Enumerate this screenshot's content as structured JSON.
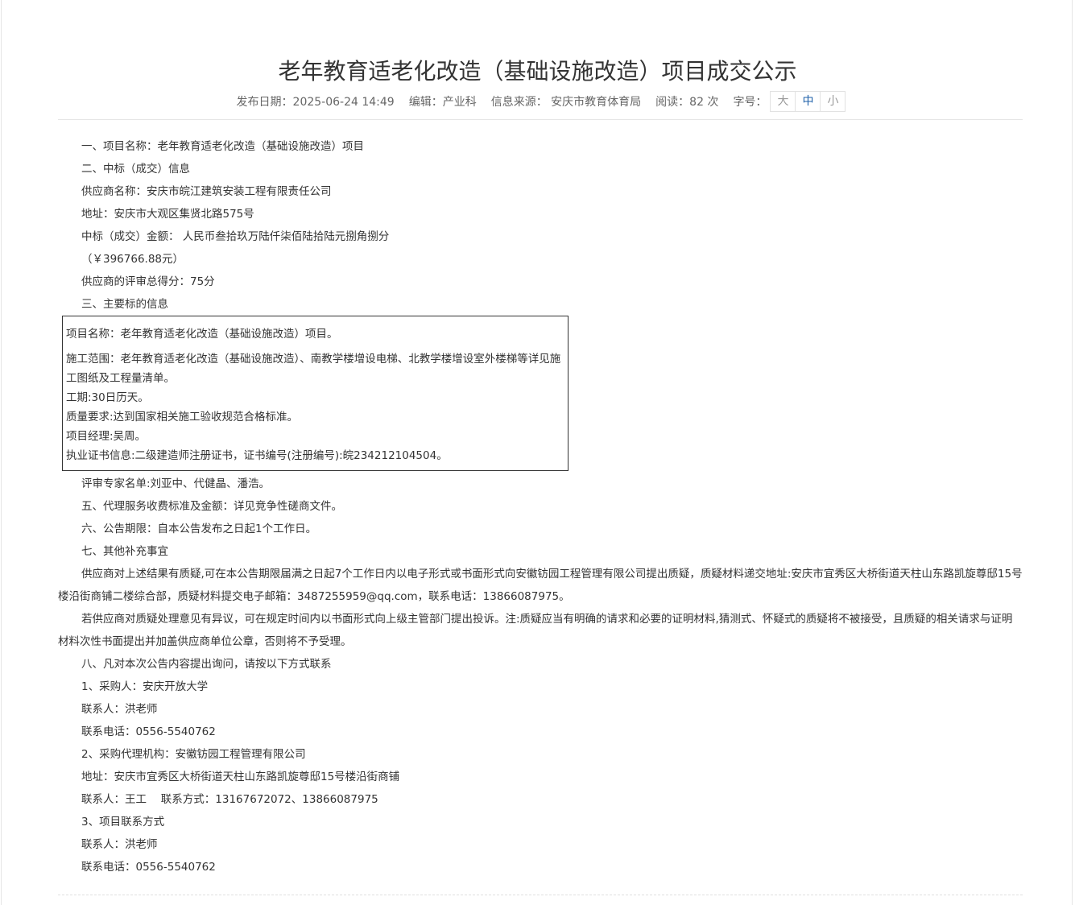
{
  "title": "老年教育适老化改造（基础设施改造）项目成交公示",
  "meta": {
    "publish_date": "发布日期：2025-06-24 14:49",
    "editor": "编辑：产业科",
    "source": "信息来源： 安庆市教育体育局",
    "reads": "阅读：82 次",
    "font_size_label": "字号：",
    "font_sizes": [
      "大",
      "中",
      "小"
    ],
    "active_font_size": "中"
  },
  "content": {
    "p1": "一、项目名称：老年教育适老化改造（基础设施改造）项目",
    "p2": "二、中标（成交）信息",
    "p3": "供应商名称：安庆市皖江建筑安装工程有限责任公司",
    "p4": "地址：安庆市大观区集贤北路575号",
    "p5": "中标（成交）金额： 人民币叁拾玖万陆仟柒佰陆拾陆元捌角捌分",
    "p6": "（￥396766.88元）",
    "p7": "供应商的评审总得分：75分",
    "p8": "三、主要标的信息",
    "box": {
      "b1": "项目名称：老年教育适老化改造（基础设施改造）项目。",
      "b2": "施工范围：老年教育适老化改造（基础设施改造）、南教学楼增设电梯、北教学楼增设室外楼梯等详见施工图纸及工程量清单。",
      "b3": "工期:30日历天。",
      "b4": "质量要求:达到国家相关施工验收规范合格标准。",
      "b5": "项目经理:吴周。",
      "b6": "执业证书信息:二级建造师注册证书，证书编号(注册编号):皖234212104504。"
    },
    "p9": "评审专家名单:刘亚中、代健晶、潘浩。",
    "p10": "五、代理服务收费标准及金额：详见竞争性磋商文件。",
    "p11": "六、公告期限：自本公告发布之日起1个工作日。",
    "p12": "七、其他补充事宜",
    "p13": "供应商对上述结果有质疑,可在本公告期限届满之日起7个工作日内以电子形式或书面形式向安徽钫园工程管理有限公司提出质疑，质疑材料递交地址:安庆市宜秀区大桥街道天柱山东路凯旋尊邸15号楼沿街商铺二楼综合部，质疑材料提交电子邮箱：3487255959@qq.com，联系电话：13866087975。",
    "p14": "若供应商对质疑处理意见有异议，可在规定时间内以书面形式向上级主管部门提出投诉。注:质疑应当有明确的请求和必要的证明材料,猜测式、怀疑式的质疑将不被接受，且质疑的相关请求与证明材料次性书面提出并加盖供应商单位公章，否则将不予受理。",
    "p15": "八、凡对本次公告内容提出询问，请按以下方式联系",
    "p16": "1、采购人：安庆开放大学",
    "p17": "联系人：洪老师",
    "p18": "联系电话：0556-5540762",
    "p19": "2、采购代理机构：安徽钫园工程管理有限公司",
    "p20": "地址：安庆市宜秀区大桥街道天柱山东路凯旋尊邸15号楼沿街商铺",
    "p21": "联系人：王工　 联系方式：13167672072、13866087975",
    "p22": "3、项目联系方式",
    "p23": "联系人：洪老师",
    "p24": "联系电话：0556-5540762"
  }
}
